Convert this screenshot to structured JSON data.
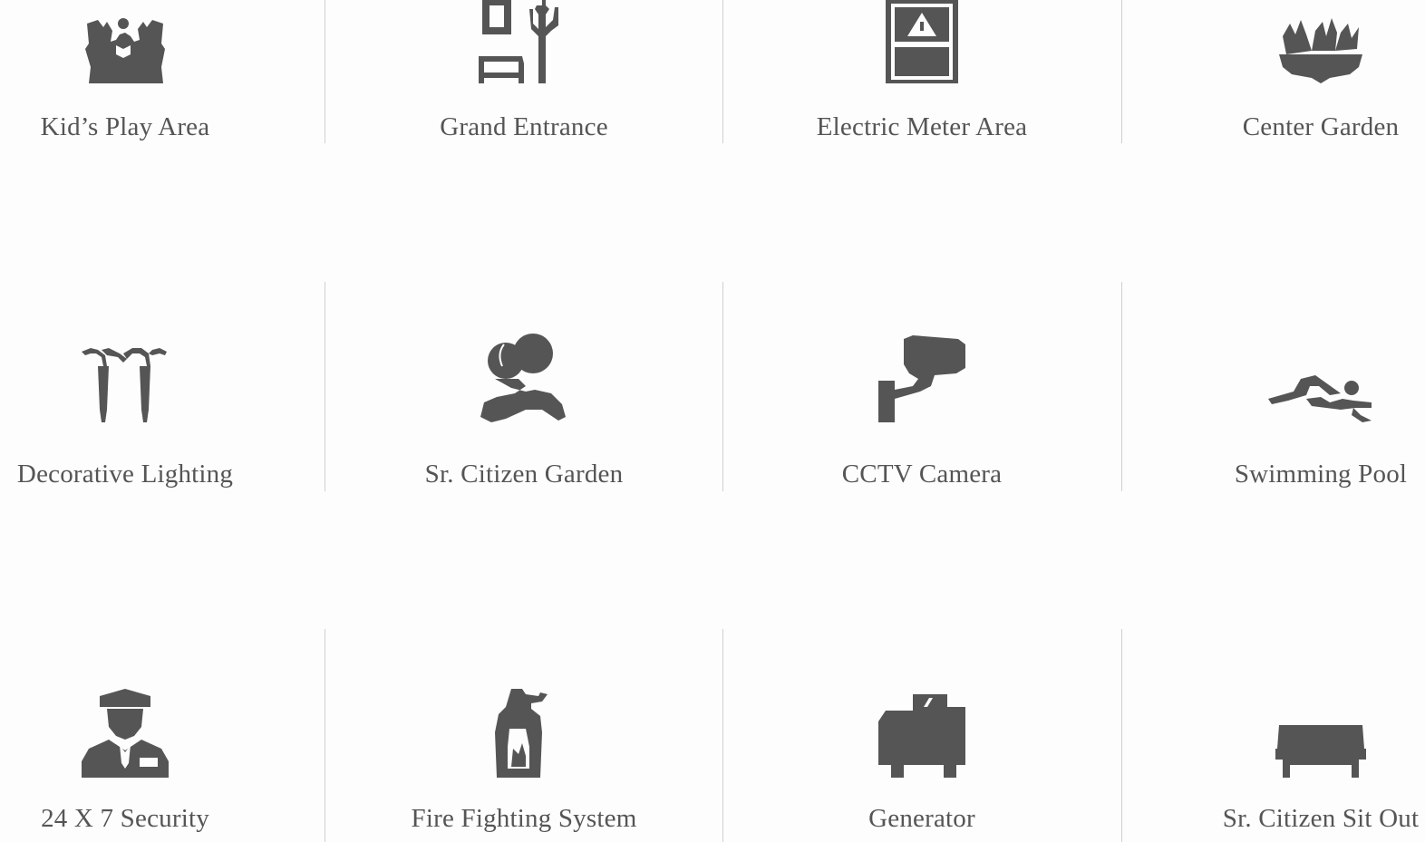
{
  "amenities": {
    "row1": [
      {
        "label": "Kid’s Play Area",
        "icon": "kids-play-area-icon"
      },
      {
        "label": "Grand Entrance",
        "icon": "grand-entrance-icon"
      },
      {
        "label": "Electric Meter Area",
        "icon": "electric-meter-icon"
      },
      {
        "label": "Center Garden",
        "icon": "garden-plant-icon"
      }
    ],
    "row2": [
      {
        "label": "Decorative Lighting",
        "icon": "decorative-lighting-icon"
      },
      {
        "label": "Sr. Citizen Garden",
        "icon": "trees-path-icon"
      },
      {
        "label": "CCTV Camera",
        "icon": "cctv-camera-icon"
      },
      {
        "label": "Swimming Pool",
        "icon": "swimmer-icon"
      }
    ],
    "row3": [
      {
        "label": "24 X 7 Security",
        "icon": "security-guard-icon"
      },
      {
        "label": "Fire Fighting System",
        "icon": "fire-extinguisher-icon"
      },
      {
        "label": "Generator",
        "icon": "generator-icon"
      },
      {
        "label": "Sr. Citizen Sit Out",
        "icon": "bench-icon"
      }
    ]
  },
  "colors": {
    "icon": "#555555",
    "text": "#555555",
    "divider": "#cfcfcf",
    "background": "#fdfdfd"
  }
}
